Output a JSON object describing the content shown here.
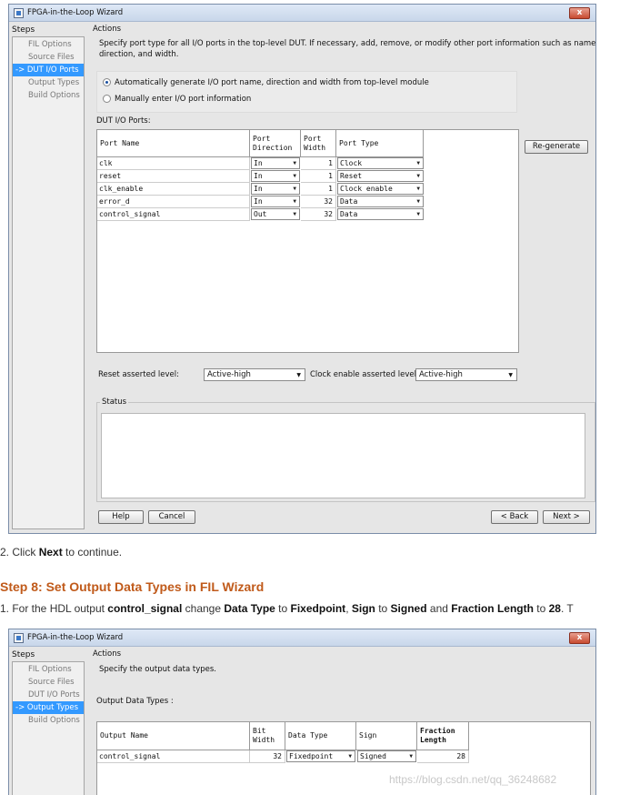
{
  "window1": {
    "title": "FPGA-in-the-Loop Wizard",
    "close_label": "x",
    "steps_header": "Steps",
    "actions_header": "Actions",
    "steps": [
      {
        "label": "FIL Options",
        "active": false
      },
      {
        "label": "Source Files",
        "active": false
      },
      {
        "label": "-> DUT I/O Ports",
        "active": true
      },
      {
        "label": "Output Types",
        "active": false
      },
      {
        "label": "Build Options",
        "active": false
      }
    ],
    "instruction_line1": "Specify port type for all I/O ports in the top-level DUT. If necessary, add, remove, or modify other port information such as name,",
    "instruction_line2": "direction, and width.",
    "radio_auto": "Automatically generate I/O port name, direction and width from top-level module",
    "radio_manual": "Manually enter I/O port information",
    "ports_label": "DUT I/O Ports:",
    "columns": {
      "name": "Port Name",
      "direction_l1": "Port",
      "direction_l2": "Direction",
      "width_l1": "Port",
      "width_l2": "Width",
      "type": "Port Type"
    },
    "rows": [
      {
        "name": "clk",
        "direction": "In",
        "width": "1",
        "type": "Clock"
      },
      {
        "name": "reset",
        "direction": "In",
        "width": "1",
        "type": "Reset"
      },
      {
        "name": "clk_enable",
        "direction": "In",
        "width": "1",
        "type": "Clock enable"
      },
      {
        "name": "error_d",
        "direction": "In",
        "width": "32",
        "type": "Data"
      },
      {
        "name": "control_signal",
        "direction": "Out",
        "width": "32",
        "type": "Data"
      }
    ],
    "regenerate_label": "Re-generate",
    "reset_level_label": "Reset asserted level:",
    "reset_level_value": "Active-high",
    "clock_enable_label": "Clock enable asserted level:",
    "clock_enable_value": "Active-high",
    "status_label": "Status",
    "help_label": "Help",
    "cancel_label": "Cancel",
    "back_label": "< Back",
    "next_label": "Next >"
  },
  "text": {
    "step2_num": "2. Click ",
    "step2_bold": "Next",
    "step2_rest": " to continue.",
    "heading": "Step 8: Set Output Data Types in FIL Wizard",
    "p1_a": "1. For the HDL output ",
    "p1_b": "control_signal",
    "p1_c": " change ",
    "p1_d": "Data Type",
    "p1_e": " to ",
    "p1_f": "Fixedpoint",
    "p1_g": ", ",
    "p1_h": "Sign",
    "p1_i": " to ",
    "p1_j": "Signed",
    "p1_k": " and ",
    "p1_l": "Fraction Length",
    "p1_m": " to ",
    "p1_n": "28",
    "p1_o": ". T"
  },
  "window2": {
    "title": "FPGA-in-the-Loop Wizard",
    "close_label": "x",
    "steps_header": "Steps",
    "actions_header": "Actions",
    "steps": [
      {
        "label": "FIL Options",
        "active": false
      },
      {
        "label": "Source Files",
        "active": false
      },
      {
        "label": "DUT I/O Ports",
        "active": false
      },
      {
        "label": "-> Output Types",
        "active": true
      },
      {
        "label": "Build Options",
        "active": false
      }
    ],
    "instruction": "Specify the output data types.",
    "output_label": "Output Data Types :",
    "columns": {
      "name": "Output Name",
      "bitwidth_l1": "Bit",
      "bitwidth_l2": "Width",
      "datatype": "Data Type",
      "sign": "Sign",
      "fraction_l1": "Fraction",
      "fraction_l2": "Length"
    },
    "row": {
      "name": "control_signal",
      "bitwidth": "32",
      "datatype": "Fixedpoint",
      "sign": "Signed",
      "fraction": "28"
    }
  },
  "watermark": "https://blog.csdn.net/qq_36248682"
}
